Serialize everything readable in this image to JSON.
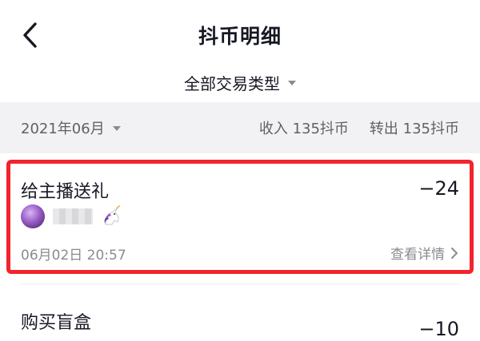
{
  "nav": {
    "title": "抖币明细"
  },
  "filter": {
    "label": "全部交易类型"
  },
  "summary": {
    "month": "2021年06月",
    "income": "收入 135抖币",
    "outgoing": "转出 135抖币"
  },
  "records": [
    {
      "title": "给主播送礼",
      "amount": "−24",
      "time": "06月02日 20:57",
      "detail_label": "查看详情"
    },
    {
      "title": "购买盲盒",
      "amount": "−10"
    }
  ],
  "colors": {
    "highlight": "#f2242c",
    "summary_bg": "#f2f2f4",
    "text_primary": "#161823",
    "text_secondary": "#8a8b91"
  }
}
